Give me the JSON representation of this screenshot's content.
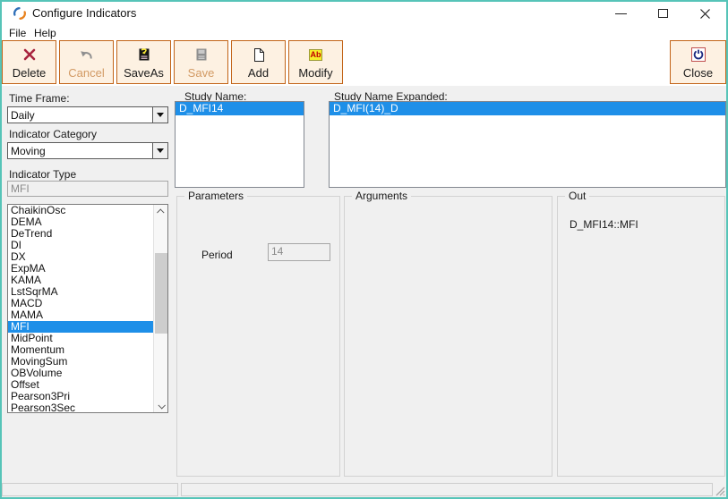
{
  "window": {
    "title": "Configure Indicators"
  },
  "menu": {
    "items": [
      "File",
      "Help"
    ]
  },
  "toolbar": {
    "buttons": [
      {
        "label": "Delete",
        "icon": "delete-x-icon",
        "enabled": true
      },
      {
        "label": "Cancel",
        "icon": "undo-arrow-icon",
        "enabled": false
      },
      {
        "label": "SaveAs",
        "icon": "save-as-floppy-icon",
        "enabled": true
      },
      {
        "label": "Save",
        "icon": "save-floppy-icon",
        "enabled": false
      },
      {
        "label": "Add",
        "icon": "new-page-icon",
        "enabled": true
      },
      {
        "label": "Modify",
        "icon": "modify-ab-icon",
        "enabled": true,
        "icon_text": "Ab"
      }
    ],
    "close_button": {
      "label": "Close",
      "icon": "power-icon"
    }
  },
  "left_panel": {
    "time_frame": {
      "label": "Time Frame:",
      "value": "Daily"
    },
    "indicator_category": {
      "label": "Indicator Category",
      "value": "Moving"
    },
    "indicator_type": {
      "label": "Indicator Type",
      "value": "MFI"
    },
    "indicator_list": {
      "items": [
        "ChaikinOsc",
        "DEMA",
        "DeTrend",
        "DI",
        "DX",
        "ExpMA",
        "KAMA",
        "LstSqrMA",
        "MACD",
        "MAMA",
        "MFI",
        "MidPoint",
        "Momentum",
        "MovingSum",
        "OBVolume",
        "Offset",
        "Pearson3Pri",
        "Pearson3Sec"
      ],
      "selected": "MFI"
    }
  },
  "study_name": {
    "label": "Study Name:",
    "items": [
      "D_MFI14"
    ],
    "selected": "D_MFI14"
  },
  "study_name_expanded": {
    "label": "Study Name Expanded:",
    "items": [
      "D_MFI(14)_D"
    ],
    "selected": "D_MFI(14)_D"
  },
  "parameters": {
    "title": "Parameters",
    "period": {
      "label": "Period",
      "value": "14"
    }
  },
  "arguments_box": {
    "title": "Arguments"
  },
  "out_box": {
    "title": "Out",
    "value": "D_MFI14::MFI"
  },
  "colors": {
    "window_border": "#56c4b8",
    "toolbar_button_bg": "#fdf1e2",
    "toolbar_button_border": "#c26418",
    "disabled_text": "#d29a64",
    "selection_blue": "#1e8fe8",
    "delete_red": "#a8243f",
    "modify_yellow": "#f7ee2b",
    "modify_red": "#c00000",
    "power_navy": "#1b2a80"
  }
}
